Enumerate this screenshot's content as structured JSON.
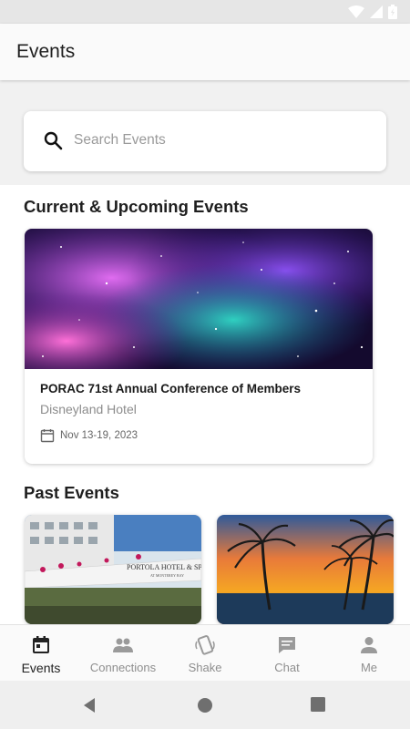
{
  "app": {
    "title": "Events"
  },
  "search": {
    "placeholder": "Search Events"
  },
  "sections": {
    "current": "Current & Upcoming Events",
    "past": "Past Events"
  },
  "current_event": {
    "title": "PORAC 71st Annual Conference of Members",
    "venue": "Disneyland Hotel",
    "date": "Nov 13-19, 2023"
  },
  "past_events": [
    {
      "image_sign_text": "PORTOLA HOTEL & SPA",
      "image_sign_subtext": "AT MONTEREY BAY"
    },
    {
      "image": "palm-trees-sunset"
    }
  ],
  "bottom_nav": [
    {
      "label": "Events",
      "icon": "calendar-icon",
      "active": true
    },
    {
      "label": "Connections",
      "icon": "people-icon",
      "active": false
    },
    {
      "label": "Shake",
      "icon": "shake-phone-icon",
      "active": false
    },
    {
      "label": "Chat",
      "icon": "chat-bubble-icon",
      "active": false
    },
    {
      "label": "Me",
      "icon": "person-icon",
      "active": false
    }
  ],
  "colors": {
    "active": "#222222",
    "inactive": "#9a9a9a",
    "accent_nebula": "#7a3fd1"
  }
}
